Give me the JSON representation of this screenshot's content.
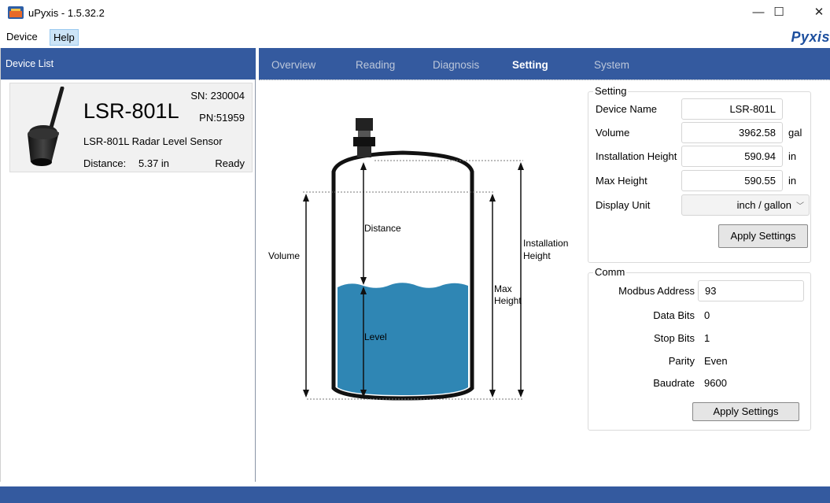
{
  "window": {
    "title": "uPyxis - 1.5.32.2",
    "minimize": "—",
    "maximize": "☐",
    "close": "✕"
  },
  "menu": {
    "device": "Device",
    "help": "Help",
    "brand": "Pyxis"
  },
  "device_list": {
    "header": "Device List",
    "device": {
      "name": "LSR-801L",
      "sn": "SN: 230004",
      "pn": "PN:51959",
      "description": "LSR-801L Radar Level Sensor",
      "distance_label": "Distance:",
      "distance_value": "5.37  in",
      "status": "Ready"
    }
  },
  "tabs": [
    "Overview",
    "Reading",
    "Diagnosis",
    "Setting",
    "System"
  ],
  "active_tab": "Setting",
  "diagram": {
    "distance": "Distance",
    "volume": "Volume",
    "level": "Level",
    "installation_height_line1": "Installation",
    "installation_height_line2": "Height",
    "max_height_line1": "Max",
    "max_height_line2": "Height"
  },
  "setting": {
    "title": "Setting",
    "device_name_label": "Device Name",
    "device_name_value": "LSR-801L",
    "volume_label": "Volume",
    "volume_value": "3962.58",
    "volume_unit": "gal",
    "install_height_label": "Installation Height",
    "install_height_value": "590.94",
    "install_height_unit": "in",
    "max_height_label": "Max Height",
    "max_height_value": "590.55",
    "max_height_unit": "in",
    "display_unit_label": "Display Unit",
    "display_unit_value": "inch / gallon",
    "apply_button": "Apply Settings"
  },
  "comm": {
    "title": "Comm",
    "modbus_label": "Modbus Address",
    "modbus_value": "93",
    "data_bits_label": "Data Bits",
    "data_bits_value": "0",
    "stop_bits_label": "Stop Bits",
    "stop_bits_value": "1",
    "parity_label": "Parity",
    "parity_value": "Even",
    "baudrate_label": "Baudrate",
    "baudrate_value": "9600",
    "apply_button": "Apply Settings"
  },
  "colors": {
    "accent": "#345a9f",
    "water": "#2f86b4",
    "brand": "#1d4f9e"
  }
}
